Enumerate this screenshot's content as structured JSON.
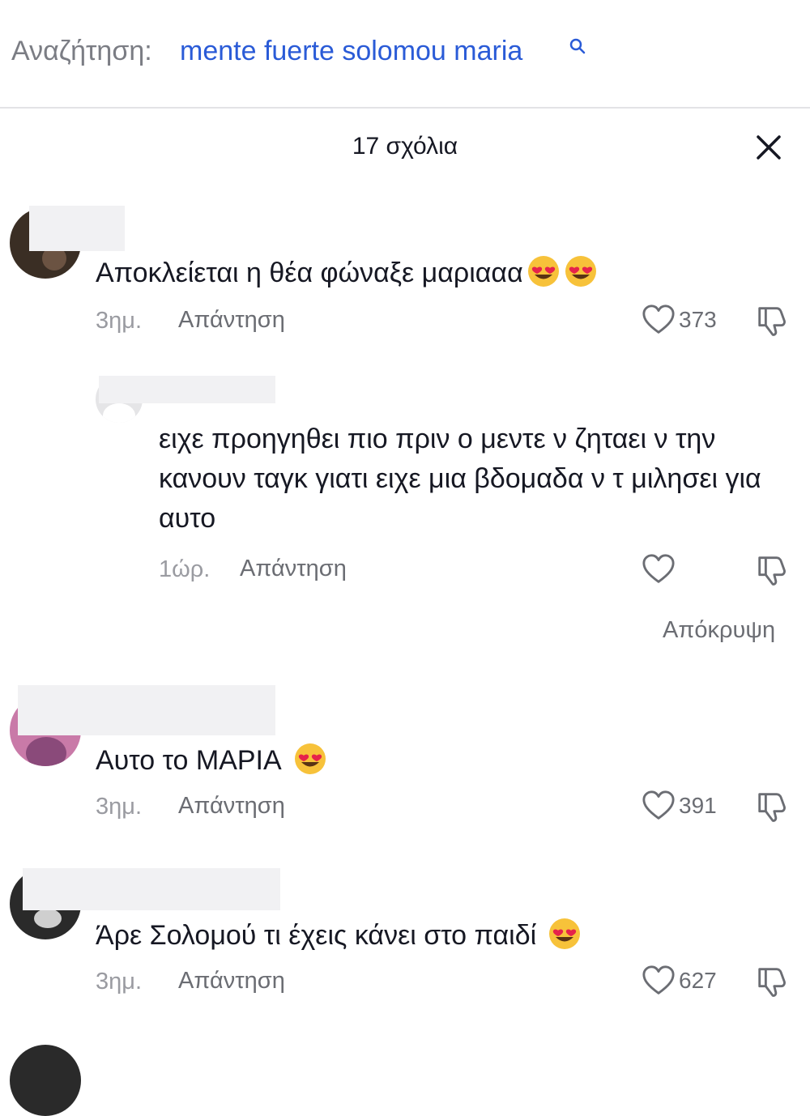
{
  "search": {
    "label": "Αναζήτηση:",
    "query": "mente fuerte solomou maria"
  },
  "header": {
    "title": "17 σχόλια"
  },
  "comments": [
    {
      "text": "Αποκλείεται η θέα φώναξε μαριααα",
      "emoji_count": 2,
      "time": "3ημ.",
      "reply_label": "Απάντηση",
      "likes": "373",
      "replies": [
        {
          "text": "ειχε προηγηθει πιο πριν ο μεντε ν ζηταει ν την κανουν ταγκ γιατι ειχε μια βδομαδα ν τ μιλησει για αυτο",
          "time": "1ώρ.",
          "reply_label": "Απάντηση"
        }
      ],
      "hide_label": "Απόκρυψη"
    },
    {
      "text": "Αυτο το ΜΑΡΙΑ",
      "emoji_count": 1,
      "time": "3ημ.",
      "reply_label": "Απάντηση",
      "likes": "391"
    },
    {
      "text": "Άρε Σολομού τι έχεις κάνει στο παιδί",
      "emoji_count": 1,
      "time": "3ημ.",
      "reply_label": "Απάντηση",
      "likes": "627"
    }
  ],
  "icons": {
    "heart": "heart-icon",
    "dislike": "thumbs-down-icon",
    "close": "close-icon",
    "search": "search-icon",
    "emoji": "heart-eyes-emoji"
  },
  "colors": {
    "link": "#2a5bd7",
    "muted": "#9a9ba1",
    "text": "#161823"
  }
}
